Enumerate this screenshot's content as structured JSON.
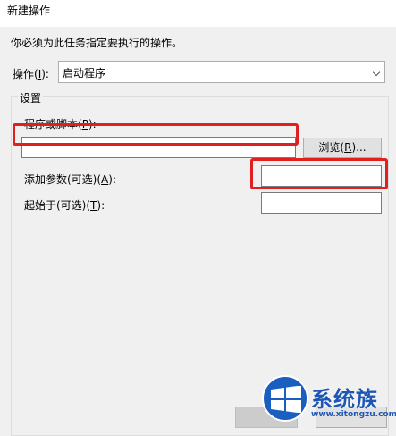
{
  "window": {
    "title": "新建操作"
  },
  "instruction": "你必须为此任务指定要执行的操作。",
  "action": {
    "label_prefix": "操作(",
    "label_key": "I",
    "label_suffix": "):",
    "value": "启动程序"
  },
  "settings": {
    "legend": "设置",
    "program_label_prefix": "程序或脚本(",
    "program_label_key": "P",
    "program_label_suffix": "):",
    "program_value": "",
    "browse_prefix": "浏览(",
    "browse_key": "R",
    "browse_suffix": ")...",
    "args_label_prefix": "添加参数(可选)(",
    "args_label_key": "A",
    "args_label_suffix": "):",
    "args_value": "",
    "start_label_prefix": "起始于(可选)(",
    "start_label_key": "T",
    "start_label_suffix": "):",
    "start_value": ""
  },
  "watermark": {
    "text": "系统族",
    "url": "www.xitongzu.com"
  },
  "colors": {
    "highlight": "#e02020",
    "background": "#f0f0f0",
    "watermark": "#1d56b4"
  }
}
